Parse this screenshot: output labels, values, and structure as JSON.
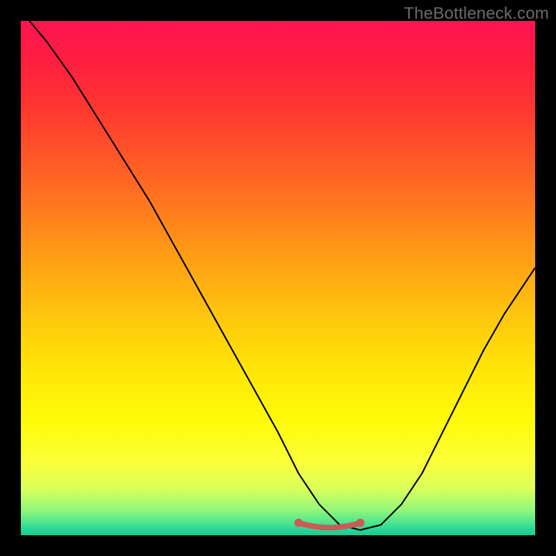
{
  "watermark": "TheBottleneck.com",
  "chart_data": {
    "type": "line",
    "title": "",
    "xlabel": "",
    "ylabel": "",
    "xlim": [
      0,
      100
    ],
    "ylim": [
      0,
      100
    ],
    "grid": false,
    "gradient_colors": {
      "top": "#ff1453",
      "mid_upper": "#ff9a16",
      "mid": "#ffe607",
      "mid_lower": "#faff3a",
      "bottom": "#10cf97"
    },
    "series": [
      {
        "name": "bottleneck-curve",
        "color": "#000000",
        "x": [
          0,
          5,
          10,
          15,
          20,
          25,
          30,
          35,
          40,
          45,
          50,
          54,
          58,
          62,
          66,
          70,
          74,
          78,
          82,
          86,
          90,
          94,
          98,
          100
        ],
        "y": [
          102,
          96,
          89,
          81,
          73,
          65,
          56,
          47,
          38,
          29,
          20,
          12,
          6,
          2,
          1,
          2,
          6,
          12,
          20,
          28,
          36,
          43,
          49,
          52
        ]
      }
    ],
    "highlight_band": {
      "name": "optimal-range",
      "color": "#cb5b57",
      "x_start": 54,
      "x_end": 66,
      "y": 2
    }
  }
}
